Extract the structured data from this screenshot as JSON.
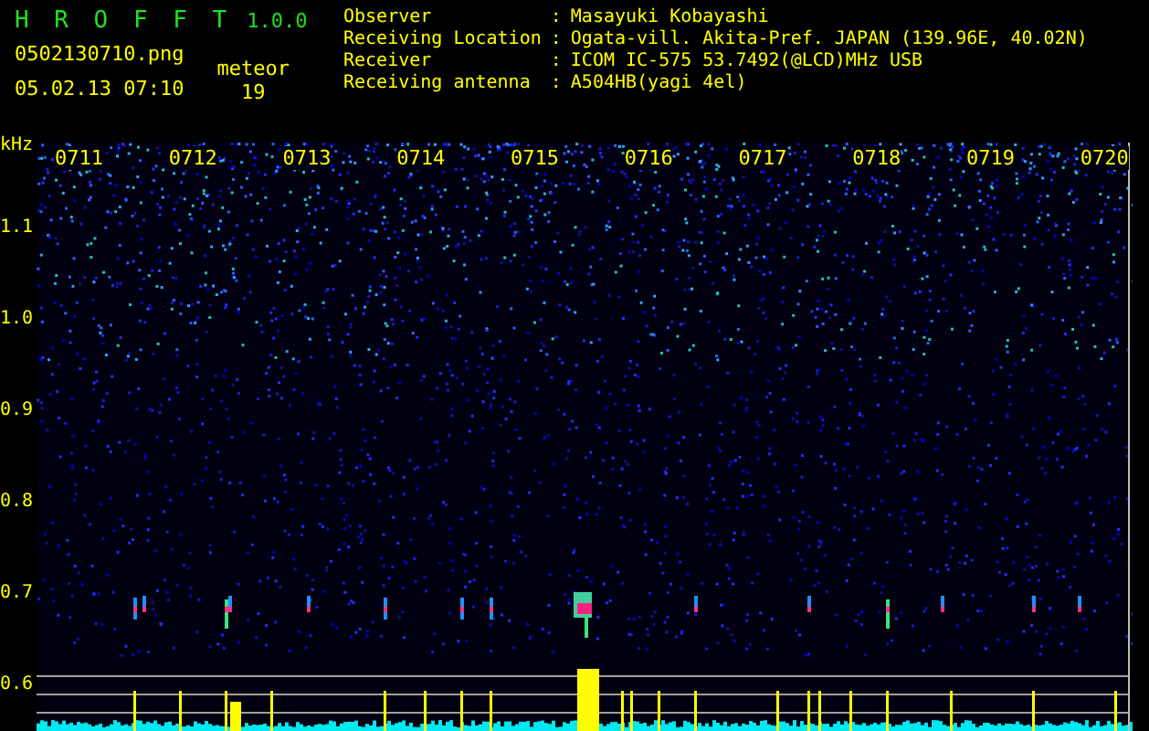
{
  "app": {
    "name": "H R O F F T",
    "version": "1.0.0",
    "file": "0502130710.png",
    "datetime": "05.02.13 07:10",
    "meteor_label": "meteor",
    "meteor_count": "19"
  },
  "info": [
    {
      "label": "Observer",
      "separator": ":",
      "value": "Masayuki Kobayashi"
    },
    {
      "label": "Receiving Location",
      "separator": ":",
      "value": "Ogata-vill. Akita-Pref. JAPAN (139.96E, 40.02N)"
    },
    {
      "label": "Receiver",
      "separator": ":",
      "value": "ICOM IC-575 53.7492(@LCD)MHz USB"
    },
    {
      "label": "Receiving antenna",
      "separator": ":",
      "value": "A504HB(yagi 4el)"
    }
  ],
  "spectrogram": {
    "unit": "kHz",
    "y_labels": [
      "1.1",
      "1.0",
      "0.9",
      "0.8",
      "0.7",
      "0.6"
    ],
    "time_labels": [
      "0711",
      "0712",
      "0713",
      "0714",
      "0715",
      "0716",
      "0717",
      "0718",
      "0719",
      "0720"
    ]
  }
}
